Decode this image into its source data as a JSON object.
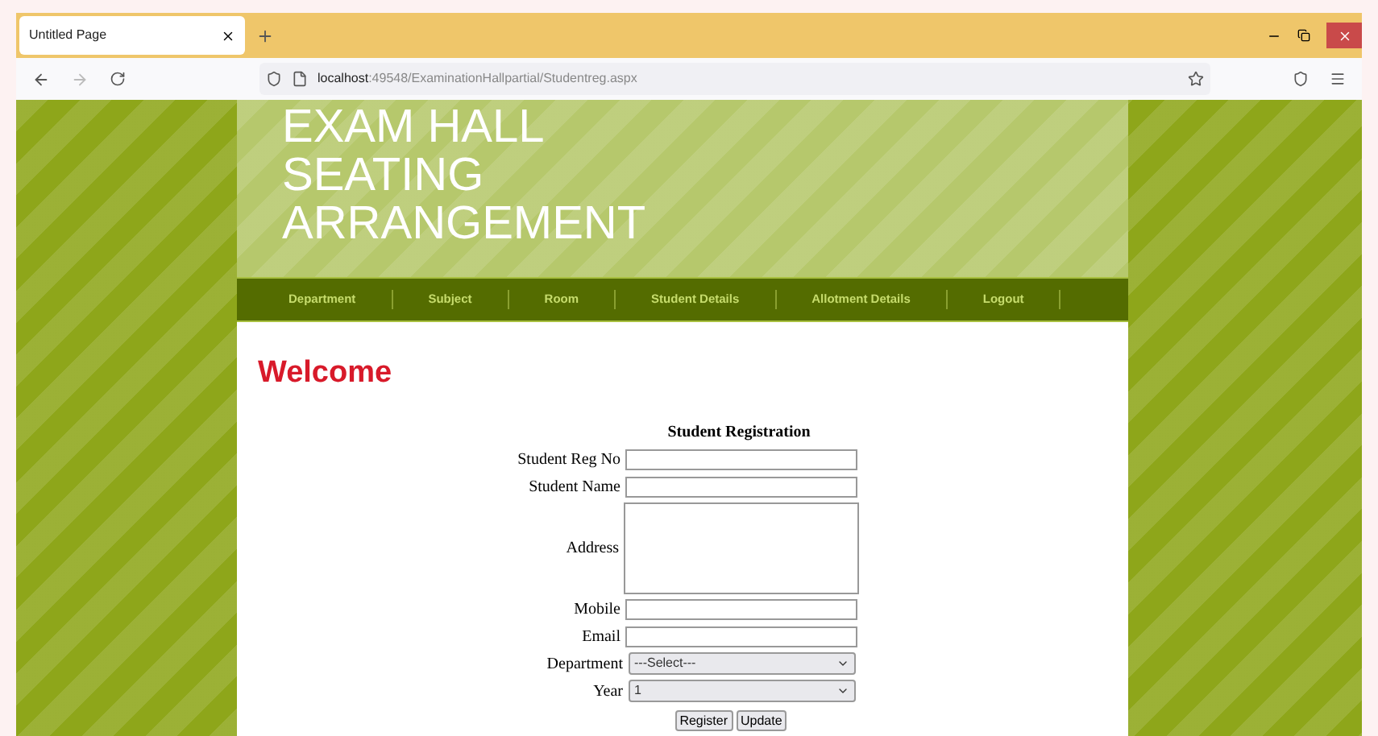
{
  "browser": {
    "tab_title": "Untitled Page",
    "url_host": "localhost",
    "url_path": ":49548/ExaminationHallpartial/Studentreg.aspx"
  },
  "header": {
    "title_lines": [
      "EXAM HALL",
      "SEATING",
      "ARRANGEMENT"
    ]
  },
  "nav": [
    "Department",
    "Subject",
    "Room",
    "Student Details",
    "Allotment Details",
    "Logout"
  ],
  "welcome": "Welcome",
  "form": {
    "title": "Student Registration",
    "fields": [
      {
        "label": "Student Reg No",
        "kind": "text"
      },
      {
        "label": "Student Name",
        "kind": "text"
      },
      {
        "label": "Address",
        "kind": "textarea"
      },
      {
        "label": "Mobile",
        "kind": "text"
      },
      {
        "label": "Email",
        "kind": "text"
      },
      {
        "label": "Department",
        "kind": "select",
        "value": "---Select---"
      },
      {
        "label": "Year",
        "kind": "select",
        "value": "1"
      }
    ],
    "buttons": [
      "Register",
      "Update"
    ]
  }
}
